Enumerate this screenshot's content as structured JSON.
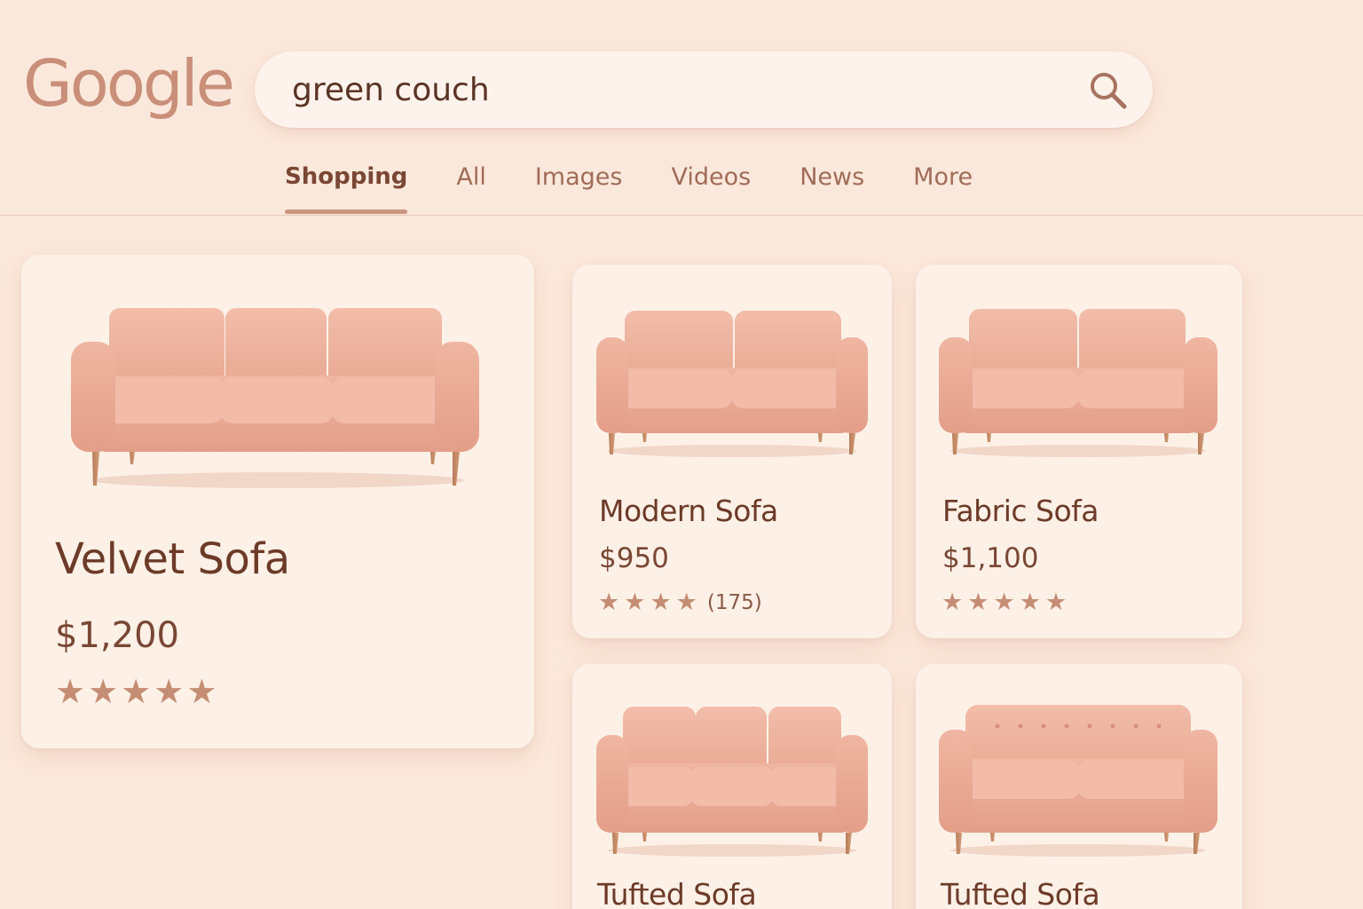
{
  "brand": {
    "logo_text": "Google"
  },
  "search": {
    "query": "green couch"
  },
  "tabs": [
    {
      "label": "Shopping",
      "active": true
    },
    {
      "label": "All"
    },
    {
      "label": "Images"
    },
    {
      "label": "Videos"
    },
    {
      "label": "News"
    },
    {
      "label": "More"
    }
  ],
  "products": {
    "featured": {
      "name": "Velvet Sofa",
      "price": "$1,200",
      "rating": 5,
      "image": "three-seat-sofa"
    },
    "items": [
      {
        "name": "Modern Sofa",
        "price": "$950",
        "rating": 4,
        "review_count": "(175)",
        "image": "loveseat-sofa"
      },
      {
        "name": "Fabric Sofa",
        "price": "$1,100",
        "rating": 5,
        "image": "loveseat-sofa"
      },
      {
        "name": "Tufted Sofa",
        "image": "three-seat-sofa"
      },
      {
        "name": "Tufted Sofa",
        "image": "tufted-sofa"
      }
    ]
  },
  "colors": {
    "background": "#fbe8dc",
    "card": "#fdf0e7",
    "sofa": "#e8a793",
    "text": "#6d3a28",
    "accent": "#c58d74"
  }
}
